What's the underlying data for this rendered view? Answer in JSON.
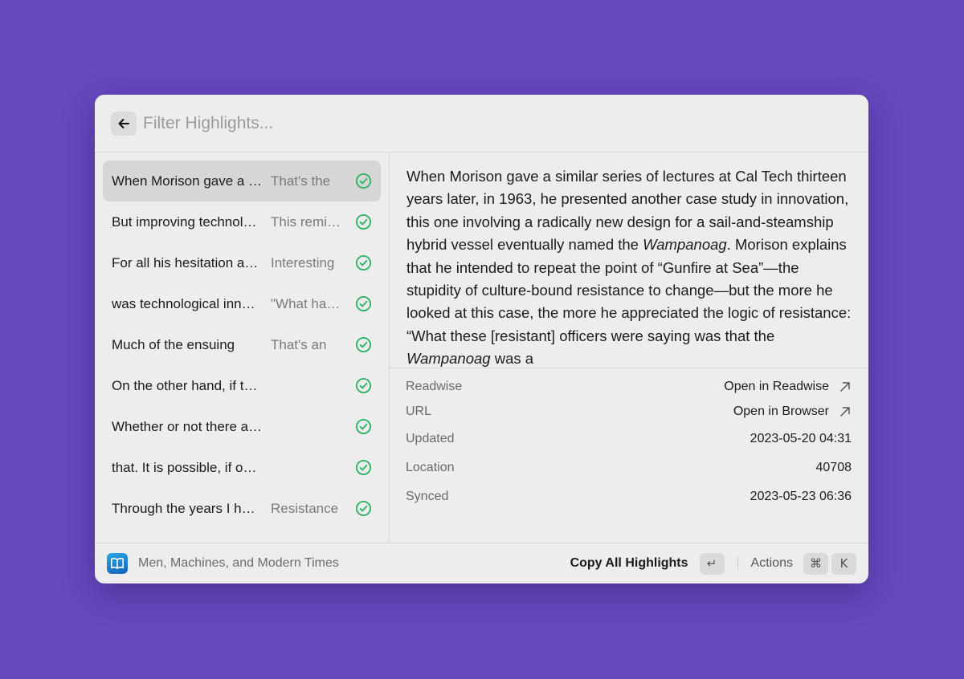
{
  "search": {
    "placeholder": "Filter Highlights...",
    "back_icon": "arrow-left-icon"
  },
  "highlights": [
    {
      "title": "When Morison gave a similar series of lectures",
      "note": "That's the",
      "synced": true,
      "selected": true
    },
    {
      "title": "But improving technology",
      "note": "This reminds",
      "synced": true
    },
    {
      "title": "For all his hesitation about",
      "note": "Interesting",
      "synced": true
    },
    {
      "title": "was technological innovation",
      "note": "\"What happens",
      "synced": true
    },
    {
      "title": "Much of the ensuing",
      "note": "That's an",
      "synced": true
    },
    {
      "title": "On the other hand, if the state of",
      "note": "",
      "synced": true
    },
    {
      "title": "Whether or not there are inventions",
      "note": "",
      "synced": true
    },
    {
      "title": "that. It is possible, if one sets aside",
      "note": "",
      "synced": true
    },
    {
      "title": "Through the years I have",
      "note": "Resistance",
      "synced": true
    }
  ],
  "detail": {
    "text_1": "When Morison gave a similar series of lectures at Cal Tech thirteen years later, in 1963, he presented another case study in innovation, this one involving a radically new design for a sail-and-steamship hybrid vessel eventually named the ",
    "italic_1": "Wampanoag",
    "text_2": ". Morison explains that he intended to repeat the point of “Gunfire at Sea”—the stupidity of culture-bound resistance to change—but the more he looked at this case, the more he appreciated the logic of resistance: “What these [resistant] officers were saying was that the ",
    "italic_2": "Wampanoag",
    "text_3": " was a"
  },
  "metadata": [
    {
      "label": "Readwise",
      "value": "Open in Readwise",
      "link": true
    },
    {
      "label": "URL",
      "value": "Open in Browser",
      "link": true
    },
    {
      "label": "Updated",
      "value": "2023-05-20 04:31"
    },
    {
      "label": "Location",
      "value": "40708"
    },
    {
      "label": "Synced",
      "value": "2023-05-23 06:36"
    }
  ],
  "footer": {
    "book_icon": "book-icon",
    "book_title": "Men, Machines, and Modern Times",
    "primary_action": "Copy All Highlights",
    "primary_shortcut": "↵",
    "actions_label": "Actions",
    "actions_shortcut_mod": "⌘",
    "actions_shortcut_key": "K"
  },
  "colors": {
    "background": "#6649bd",
    "check": "#2fb467",
    "selected_row": "#d6d6d6"
  }
}
